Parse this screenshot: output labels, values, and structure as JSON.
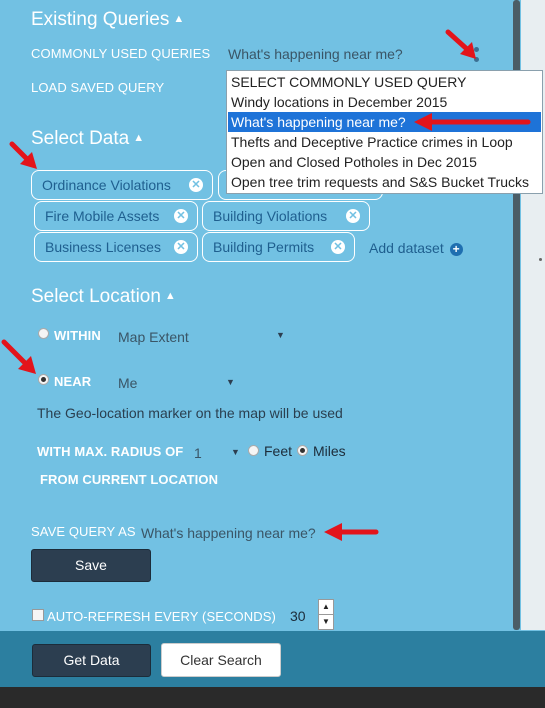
{
  "existing_queries": {
    "title": "Existing Queries",
    "commonly_used_label": "COMMONLY USED QUERIES",
    "commonly_used_value": "What's happening near me?",
    "load_saved_label": "LOAD SAVED QUERY",
    "dropdown_options": [
      "SELECT COMMONLY USED QUERY",
      "Windy locations in December 2015",
      "What's happening near me?",
      "Thefts and Deceptive Practice crimes in Loop",
      "Open and Closed Potholes in Dec 2015",
      "Open tree trim requests and S&S Bucket Trucks"
    ],
    "selected_index": 2
  },
  "select_data": {
    "title": "Select Data",
    "datasets": [
      "Ordinance Violations",
      "Fire Mobile Assets",
      "Building Violations",
      "Business Licenses",
      "Building Permits"
    ],
    "add_dataset_label": "Add dataset"
  },
  "select_location": {
    "title": "Select Location",
    "within_label": "WITHIN",
    "within_value": "Map Extent",
    "near_label": "NEAR",
    "near_value": "Me",
    "near_selected": true,
    "geo_note": "The Geo-location marker on the map will be used",
    "radius_label": "WITH MAX. RADIUS OF",
    "radius_value": "1",
    "unit_feet": "Feet",
    "unit_miles": "Miles",
    "unit_selected": "Miles",
    "from_label": "FROM CURRENT LOCATION"
  },
  "save_query": {
    "label": "SAVE QUERY AS",
    "value": "What's happening near me?",
    "save_button": "Save"
  },
  "auto_refresh": {
    "label": "AUTO-REFRESH EVERY (SECONDS)",
    "value": "30",
    "checked": false
  },
  "footer": {
    "get_data": "Get Data",
    "clear_search": "Clear Search"
  },
  "colors": {
    "panel": "#72c1e3",
    "dark_button": "#2c3e50",
    "selected_option": "#1e73d8",
    "annotation_arrow": "#e3141b"
  }
}
